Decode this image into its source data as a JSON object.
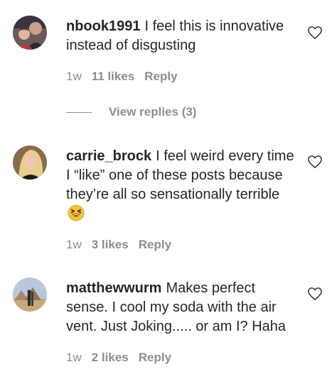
{
  "comments": [
    {
      "username": "nbook1991",
      "text": "I feel this is innovative instead of disgusting",
      "time": "1w",
      "likes": "11 likes",
      "reply": "Reply",
      "view_replies": "View replies (3)"
    },
    {
      "username": "carrie_brock",
      "text": "I feel weird every time I “like” one of these posts because they’re all so sensationally terrible",
      "emoji": "laughing-squint-emoji",
      "time": "1w",
      "likes": "3 likes",
      "reply": "Reply"
    },
    {
      "username": "matthewwurm",
      "text": "Makes perfect sense. I cool my soda with the air vent. Just Joking..... or am I? Haha",
      "time": "1w",
      "likes": "2 likes",
      "reply": "Reply"
    }
  ],
  "icons": {
    "like": "heart-outline-icon"
  },
  "colors": {
    "text": "#262626",
    "secondary": "#8e8e8e",
    "emoji": "#f5c33b"
  }
}
